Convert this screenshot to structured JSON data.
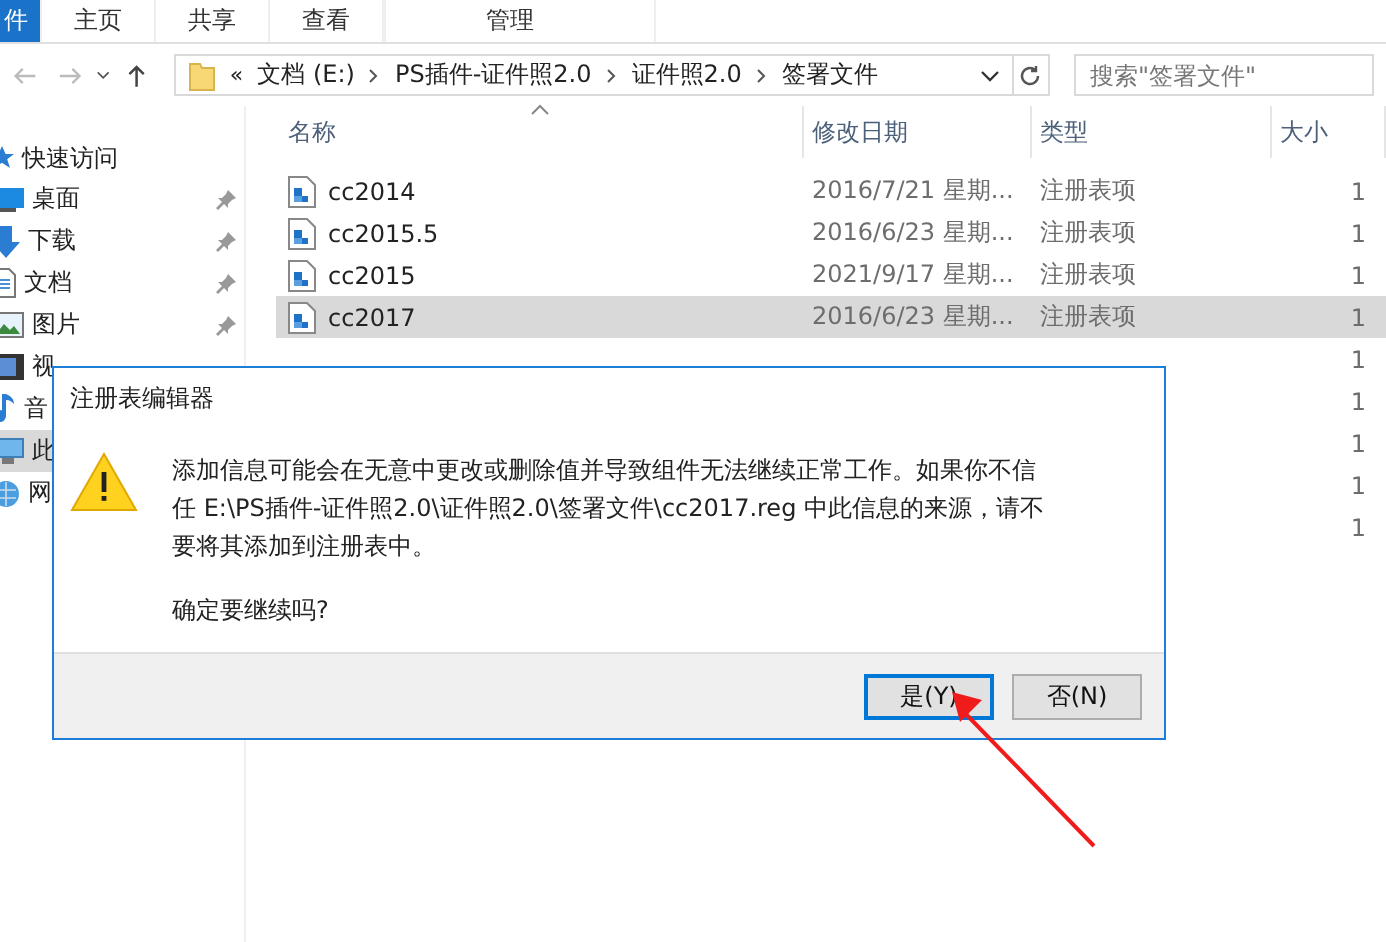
{
  "ribbon_tabs": [
    {
      "label": "件",
      "selected": true
    },
    {
      "label": "主页",
      "selected": false
    },
    {
      "label": "共享",
      "selected": false
    },
    {
      "label": "查看",
      "selected": false
    },
    {
      "label": "管理",
      "selected": false
    }
  ],
  "address_bar": {
    "overflow": "«",
    "breadcrumbs": [
      "文档 (E:)",
      "PS插件-证件照2.0",
      "证件照2.0",
      "签署文件"
    ]
  },
  "search": {
    "placeholder": "搜索\"签署文件\""
  },
  "sidebar": {
    "items": [
      {
        "label": "快速访问",
        "kind": "quick",
        "pinned": false,
        "selected": false
      },
      {
        "label": "桌面",
        "kind": "desktop",
        "pinned": true,
        "selected": false
      },
      {
        "label": "下载",
        "kind": "download",
        "pinned": true,
        "selected": false
      },
      {
        "label": "文档",
        "kind": "document",
        "pinned": true,
        "selected": false
      },
      {
        "label": "图片",
        "kind": "picture",
        "pinned": true,
        "selected": false
      },
      {
        "label": "视",
        "kind": "video",
        "pinned": false,
        "selected": false
      },
      {
        "label": "音",
        "kind": "music",
        "pinned": false,
        "selected": false
      },
      {
        "label": "此",
        "kind": "computer",
        "pinned": false,
        "selected": true
      },
      {
        "label": "网",
        "kind": "network",
        "pinned": false,
        "selected": false
      }
    ]
  },
  "table": {
    "columns": [
      "名称",
      "修改日期",
      "类型",
      "大小"
    ],
    "rows": [
      {
        "name": "cc2014",
        "date": "2016/7/21 星期...",
        "type": "注册表项",
        "size": "1",
        "selected": false
      },
      {
        "name": "cc2015.5",
        "date": "2016/6/23 星期...",
        "type": "注册表项",
        "size": "1",
        "selected": false
      },
      {
        "name": "cc2015",
        "date": "2021/9/17 星期...",
        "type": "注册表项",
        "size": "1",
        "selected": false
      },
      {
        "name": "cc2017",
        "date": "2016/6/23 星期...",
        "type": "注册表项",
        "size": "1",
        "selected": true
      },
      {
        "size": "1",
        "selected": false
      },
      {
        "size": "1",
        "selected": false
      },
      {
        "size": "1",
        "selected": false
      },
      {
        "size": "1",
        "selected": false
      },
      {
        "size": "1",
        "selected": false
      }
    ]
  },
  "dialog": {
    "title": "注册表编辑器",
    "message": "添加信息可能会在无意中更改或删除值并导致组件无法继续正常工作。如果你不信任 E:\\PS插件-证件照2.0\\证件照2.0\\签署文件\\cc2017.reg 中此信息的来源，请不要将其添加到注册表中。",
    "question": "确定要继续吗?",
    "buttons": [
      {
        "label": "是(Y)",
        "default": true
      },
      {
        "label": "否(N)",
        "default": false
      }
    ]
  }
}
